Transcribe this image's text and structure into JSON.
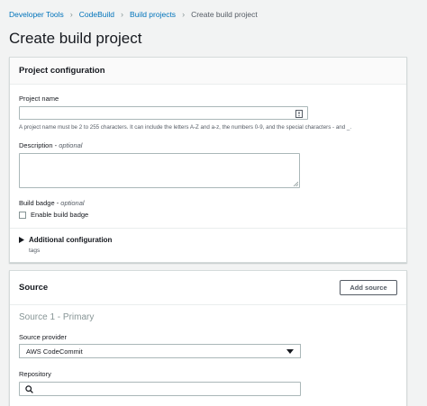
{
  "breadcrumb": {
    "items": [
      "Developer Tools",
      "CodeBuild",
      "Build projects"
    ],
    "current": "Create build project"
  },
  "page_title": "Create build project",
  "project_configuration": {
    "title": "Project configuration",
    "project_name_label": "Project name",
    "project_name_value": "",
    "project_name_hint": "A project name must be 2 to 255 characters. It can include the letters A-Z and a-z, the numbers 0-9, and the special characters - and _.",
    "description_label": "Description -",
    "description_optional": "optional",
    "description_value": "",
    "build_badge_label": "Build badge -",
    "build_badge_optional": "optional",
    "enable_badge_label": "Enable build badge",
    "enable_badge_checked": false,
    "additional_config_label": "Additional configuration",
    "additional_config_sub": "tags"
  },
  "source": {
    "title": "Source",
    "add_source_label": "Add source",
    "primary_label": "Source 1 - Primary",
    "provider_label": "Source provider",
    "provider_value": "AWS CodeCommit",
    "repository_label": "Repository",
    "repository_value": ""
  },
  "colors": {
    "link": "#0073bb",
    "background": "#f2f3f3",
    "border": "#aab7b8"
  }
}
